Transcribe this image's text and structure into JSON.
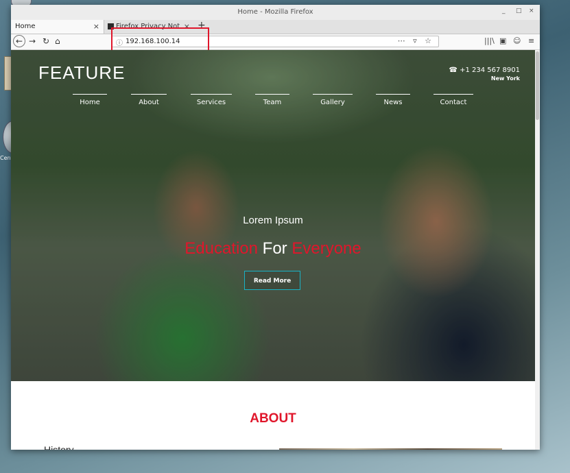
{
  "desktop": {
    "icon_label": "Cent"
  },
  "browser": {
    "window_title": "Home - Mozilla Firefox",
    "window_controls": [
      "_",
      "□",
      "×"
    ],
    "tabs": [
      {
        "label": "Home",
        "close": "×"
      },
      {
        "label": "Firefox Privacy Notice —",
        "close": "×"
      }
    ],
    "new_tab": "+",
    "nav": {
      "back": "←",
      "forward": "→",
      "reload": "↻",
      "home": "⌂"
    },
    "url": "192.168.100.14",
    "url_info_icon": "ⓘ",
    "url_actions": "⋯ ▿ ☆",
    "toolbar_icons": [
      "|||\\",
      "▣",
      "☺",
      "≡"
    ]
  },
  "site": {
    "brand": "FEATURE",
    "phone": "☎ +1 234 567 8901",
    "city": "New York",
    "nav": [
      "Home",
      "About",
      "Services",
      "Team",
      "Gallery",
      "News",
      "Contact"
    ],
    "hero_sub": "Lorem Ipsum",
    "hero_title": {
      "w1": "Education",
      "w2": " For ",
      "w3": "Everyone"
    },
    "read_more": "Read More",
    "about_title": "ABOUT",
    "history": "History"
  },
  "colors": {
    "accent_red": "#e0162b",
    "button_border": "#19b3c6"
  }
}
